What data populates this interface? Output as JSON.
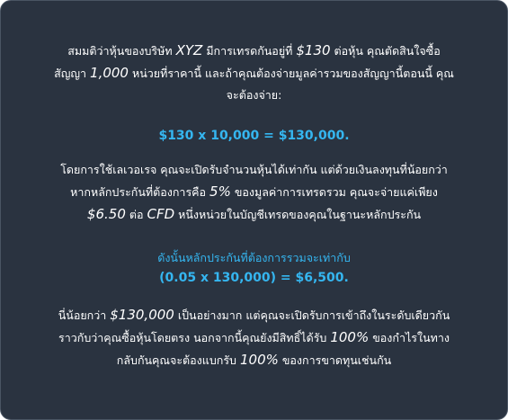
{
  "colors": {
    "background": "#2a3340",
    "text": "#ffffff",
    "accent": "#35b6f0"
  },
  "example": {
    "intro_line1_a": "สมมติว่าหุ้นของบริษัท",
    "company": "XYZ",
    "intro_line1_b": "มีการเทรดกันอยู่ที่",
    "price": "$130",
    "intro_line1_c": "ต่อหุ้น คุณตัดสินใจซื้อ",
    "intro_line2_a": "สัญญา",
    "units": "1,000",
    "intro_line2_b": "หน่วยที่ราคานี้ และถ้าคุณต้องจ่ายมูลค่ารวมของสัญญานี้ตอนนี้ คุณ",
    "intro_line3": "จะต้องจ่าย:",
    "formula_full": "$130 x 10,000 = $130,000.",
    "leverage_line1": "โดยการใช้เลเวอเรจ คุณจะเปิดรับจำนวนหุ้นได้เท่ากัน แต่ด้วยเงินลงทุนที่น้อยกว่า",
    "leverage_line2_a": "หากหลักประกันที่ต้องการคือ",
    "margin_pct": "5%",
    "leverage_line2_b": "ของมูลค่าการเทรดรวม คุณจะจ่ายแค่เพียง",
    "margin_amount": "$6.50",
    "leverage_line3_a": "ต่อ",
    "cfd": "CFD",
    "leverage_line3_b": "หนึ่งหน่วยในบัญชีเทรดของคุณในฐานะหลักประกัน",
    "margin_label": "ดังนั้นหลักประกันที่ต้องการรวมจะเท่ากับ",
    "formula_margin": "(0.05 x 130,000) = $6,500.",
    "summary_line1_a": "นี่น้อยกว่า",
    "full_value": "$130,000",
    "summary_line1_b": "เป็นอย่างมาก แต่คุณจะเปิดรับการเข้าถึงในระดับเดียวกัน",
    "summary_line2_a": "ราวกับว่าคุณซื้อหุ้นโดยตรง นอกจากนี้คุณยังมีสิทธิ์ได้รับ",
    "profit_pct": "100%",
    "summary_line2_b": "ของกำไรในทาง",
    "summary_line3_a": "กลับกันคุณจะต้องแบกรับ",
    "loss_pct": "100%",
    "summary_line3_b": "ของการขาดทุนเช่นกัน"
  }
}
